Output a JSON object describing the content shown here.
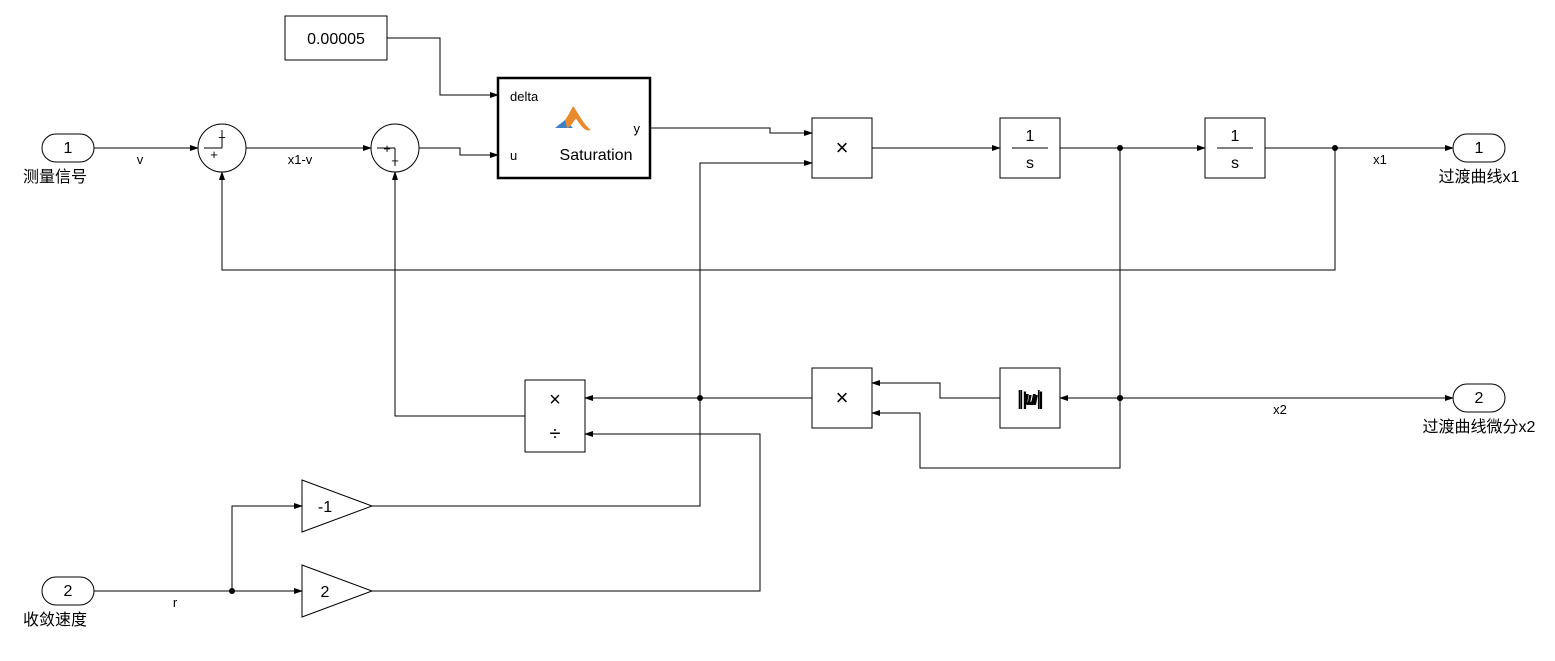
{
  "inputs": {
    "in1": {
      "num": "1",
      "label": "测量信号",
      "sig": "v"
    },
    "in2": {
      "num": "2",
      "label": "收敛速度",
      "sig": "r"
    }
  },
  "outputs": {
    "out1": {
      "num": "1",
      "label": "过渡曲线x1",
      "sig": "x1"
    },
    "out2": {
      "num": "2",
      "label": "过渡曲线微分x2",
      "sig": "x2"
    }
  },
  "blocks": {
    "const": {
      "value": "0.00005"
    },
    "satfun": {
      "port_delta": "delta",
      "port_u": "u",
      "port_y": "y",
      "name": "Saturation"
    },
    "prod1": {
      "sym": "×"
    },
    "int1": {
      "num": "1",
      "den": "s"
    },
    "int2": {
      "num": "1",
      "den": "s"
    },
    "abs": {
      "expr": "|u|"
    },
    "prod2": {
      "sym": "×"
    },
    "divide": {
      "sym_top": "×",
      "sym_bot": "÷"
    },
    "gain_n1": {
      "k": "-1"
    },
    "gain_2": {
      "k": "2"
    }
  },
  "sum1": {
    "top": "−",
    "left": "+"
  },
  "sum2": {
    "bot": "+",
    "left": "+"
  },
  "labels": {
    "x1_v": "x1-v"
  }
}
